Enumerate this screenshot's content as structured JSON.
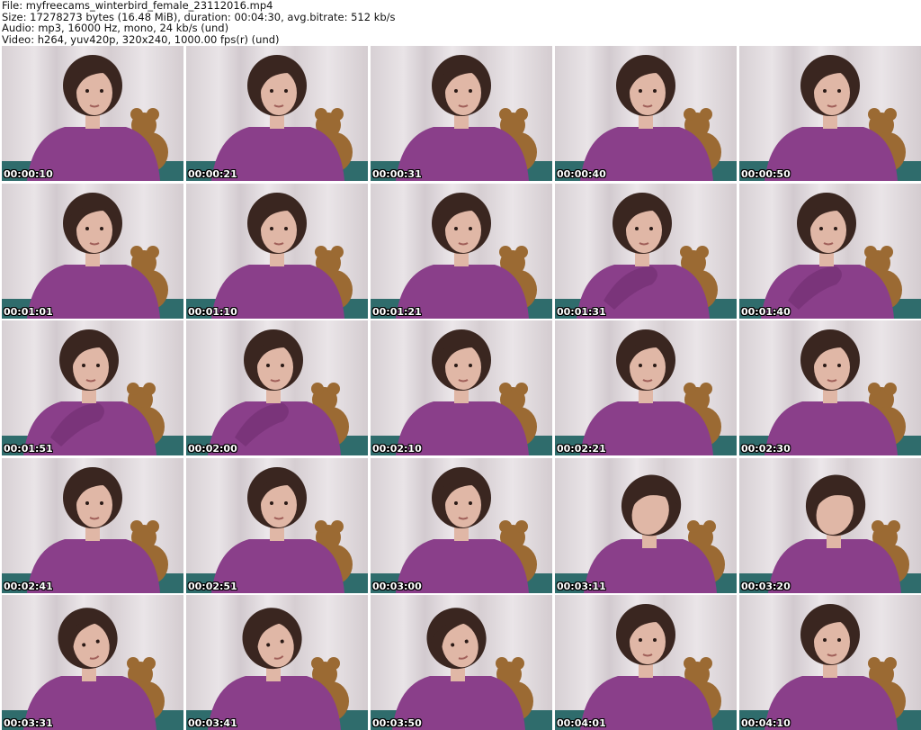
{
  "header": {
    "file": "File: myfreecams_winterbird_female_23112016.mp4",
    "size": "Size: 17278273 bytes (16.48 MiB), duration: 00:04:30, avg.bitrate: 512 kb/s",
    "audio": "Audio: mp3, 16000 Hz, mono, 24 kb/s (und)",
    "video": "Video: h264, yuv420p, 320x240, 1000.00 fps(r) (und)"
  },
  "colors": {
    "sweater": "#8a3f8a",
    "hair": "#3a2620",
    "skin": "#e0b7a6",
    "teddy": "#9b6a33",
    "curtain": "#ddd6da",
    "floor": "#2f6c6c"
  },
  "thumbnails": [
    {
      "time": "00:00:10",
      "pose": "center"
    },
    {
      "time": "00:00:21",
      "pose": "center"
    },
    {
      "time": "00:00:31",
      "pose": "center"
    },
    {
      "time": "00:00:40",
      "pose": "center"
    },
    {
      "time": "00:00:50",
      "pose": "center"
    },
    {
      "time": "00:01:01",
      "pose": "center"
    },
    {
      "time": "00:01:10",
      "pose": "center"
    },
    {
      "time": "00:01:21",
      "pose": "center"
    },
    {
      "time": "00:01:31",
      "pose": "arm"
    },
    {
      "time": "00:01:40",
      "pose": "arm"
    },
    {
      "time": "00:01:51",
      "pose": "arm"
    },
    {
      "time": "00:02:00",
      "pose": "arm"
    },
    {
      "time": "00:02:10",
      "pose": "center"
    },
    {
      "time": "00:02:21",
      "pose": "center"
    },
    {
      "time": "00:02:30",
      "pose": "center"
    },
    {
      "time": "00:02:41",
      "pose": "center"
    },
    {
      "time": "00:02:51",
      "pose": "center"
    },
    {
      "time": "00:03:00",
      "pose": "center"
    },
    {
      "time": "00:03:11",
      "pose": "down"
    },
    {
      "time": "00:03:20",
      "pose": "down"
    },
    {
      "time": "00:03:31",
      "pose": "tilt"
    },
    {
      "time": "00:03:41",
      "pose": "tilt"
    },
    {
      "time": "00:03:50",
      "pose": "tilt"
    },
    {
      "time": "00:04:01",
      "pose": "center"
    },
    {
      "time": "00:04:10",
      "pose": "center"
    }
  ]
}
